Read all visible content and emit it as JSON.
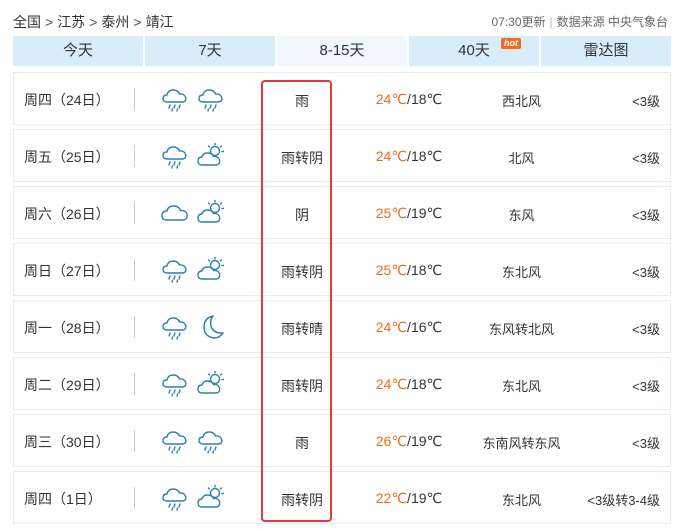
{
  "breadcrumb": {
    "items": [
      "全国",
      "江苏",
      "泰州",
      "靖江"
    ]
  },
  "source": {
    "update_time": "07:30更新",
    "source_label": "数据来源 中央气象台"
  },
  "tabs": [
    {
      "label": "今天",
      "active": false,
      "hot": false
    },
    {
      "label": "7天",
      "active": false,
      "hot": false
    },
    {
      "label": "8-15天",
      "active": true,
      "hot": false
    },
    {
      "label": "40天",
      "active": false,
      "hot": true,
      "badge": "hot"
    },
    {
      "label": "雷达图",
      "active": false,
      "hot": false
    }
  ],
  "forecast": [
    {
      "day": "周四（24日）",
      "icons": [
        "rain-cloud-icon",
        "rain-cloud-icon"
      ],
      "desc": "雨",
      "high": "24℃",
      "low": "18℃",
      "wind": "西北风",
      "level": "<3级"
    },
    {
      "day": "周五（25日）",
      "icons": [
        "rain-cloud-icon",
        "partly-cloudy-icon"
      ],
      "desc": "雨转阴",
      "high": "24℃",
      "low": "18℃",
      "wind": "北风",
      "level": "<3级"
    },
    {
      "day": "周六（26日）",
      "icons": [
        "cloud-icon",
        "partly-cloudy-icon"
      ],
      "desc": "阴",
      "high": "25℃",
      "low": "19℃",
      "wind": "东风",
      "level": "<3级"
    },
    {
      "day": "周日（27日）",
      "icons": [
        "rain-cloud-icon",
        "partly-cloudy-icon"
      ],
      "desc": "雨转阴",
      "high": "25℃",
      "low": "18℃",
      "wind": "东北风",
      "level": "<3级"
    },
    {
      "day": "周一（28日）",
      "icons": [
        "rain-cloud-icon",
        "moon-icon"
      ],
      "desc": "雨转晴",
      "high": "24℃",
      "low": "16℃",
      "wind": "东风转北风",
      "level": "<3级"
    },
    {
      "day": "周二（29日）",
      "icons": [
        "rain-cloud-icon",
        "partly-cloudy-icon"
      ],
      "desc": "雨转阴",
      "high": "24℃",
      "low": "18℃",
      "wind": "东北风",
      "level": "<3级"
    },
    {
      "day": "周三（30日）",
      "icons": [
        "rain-cloud-icon",
        "rain-cloud-icon"
      ],
      "desc": "雨",
      "high": "26℃",
      "low": "19℃",
      "wind": "东南风转东风",
      "level": "<3级"
    },
    {
      "day": "周四（1日）",
      "icons": [
        "rain-cloud-icon",
        "partly-cloudy-icon"
      ],
      "desc": "雨转阴",
      "high": "22℃",
      "low": "19℃",
      "wind": "东北风",
      "level": "<3级转3-4级"
    }
  ],
  "colors": {
    "tab_bg": "#d9ecfa",
    "tab_active_bg": "#f0f7fd",
    "high_temp": "#f26a1b",
    "hot_badge": "#f26a1b",
    "highlight_border": "#e53935",
    "icon_stroke": "#2f7fb8"
  }
}
